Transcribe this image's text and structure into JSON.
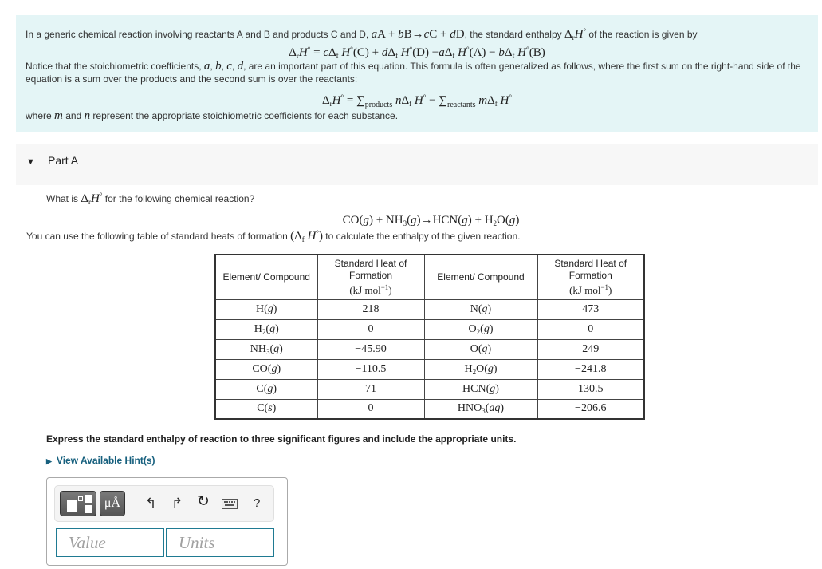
{
  "intro": {
    "p1_before": "In a generic chemical reaction involving reactants A and B and products C and D, ",
    "p1_reaction": "aA + bB→cC + dD",
    "p1_after": ", the standard enthalpy ",
    "p1_symbol": "ΔrH°",
    "p1_end": " of the reaction is given by",
    "eq1": "ΔrH° = cΔfH°(C) + dΔfH°(D) −aΔfH°(A) − bΔfH°(B)",
    "p2": "Notice that the stoichiometric coefficients, a, b, c, d, are an important part of this equation. This formula is often generalized as follows, where the first sum on the right-hand side of the equation is a sum over the products and the second sum is over the reactants:",
    "eq2": "ΔrH° = Σproducts nΔfH° − Σreactants mΔfH°",
    "p3": "where m and n represent the appropriate stoichiometric coefficients for each substance."
  },
  "part": {
    "label": "Part A",
    "expanded": true
  },
  "question": {
    "q1_before": "What is ",
    "q1_after": " for the following chemical reaction?",
    "reaction": "CO(g) + NH3(g)→HCN(g) + H2O(g)",
    "q2_before": "You can use the following table of standard heats of formation ",
    "q2_after": " to calculate the enthalpy of the given reaction."
  },
  "table": {
    "headers": [
      "Element/ Compound",
      "Standard Heat of Formation (kJ mol−1)",
      "Element/ Compound",
      "Standard Heat of Formation (kJ mol−1)"
    ],
    "header_col1": "Element/ Compound",
    "header_col2_l1": "Standard Heat of",
    "header_col2_l2": "Formation",
    "header_unit": "(kJ mol",
    "header_unit_exp": "−1",
    "rows": [
      {
        "c1": "H(g)",
        "v1": "218",
        "c2": "N(g)",
        "v2": "473"
      },
      {
        "c1": "H2(g)",
        "v1": "0",
        "c2": "O2(g)",
        "v2": "0"
      },
      {
        "c1": "NH3(g)",
        "v1": "−45.90",
        "c2": "O(g)",
        "v2": "249"
      },
      {
        "c1": "CO(g)",
        "v1": "−110.5",
        "c2": "H2O(g)",
        "v2": "−241.8"
      },
      {
        "c1": "C(g)",
        "v1": "71",
        "c2": "HCN(g)",
        "v2": "130.5"
      },
      {
        "c1": "C(s)",
        "v1": "0",
        "c2": "HNO3(aq)",
        "v2": "−206.6"
      }
    ]
  },
  "instruction": "Express the standard enthalpy of reaction to three significant figures and include the appropriate units.",
  "hint_link": "View Available Hint(s)",
  "answer": {
    "toolbar": {
      "templates_icon": "templates-icon",
      "units_button": "μÅ",
      "undo_icon": "undo-icon",
      "redo_icon": "redo-icon",
      "reset_icon": "reset-icon",
      "keyboard_icon": "keyboard-icon",
      "help_label": "?"
    },
    "value_placeholder": "Value",
    "units_placeholder": "Units",
    "value": "",
    "units": ""
  }
}
